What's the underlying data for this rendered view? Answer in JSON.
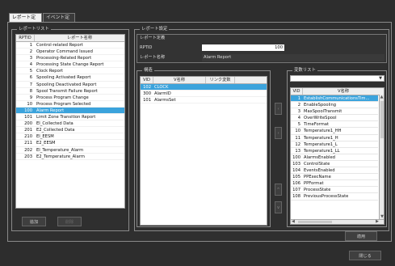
{
  "tabs": [
    "レポート定義",
    "イベント定義"
  ],
  "report_list": {
    "label": "レポートリスト",
    "header_id": "RPTID",
    "header_name": "レポート名称",
    "items": [
      {
        "id": "1",
        "name": "Control-related Report"
      },
      {
        "id": "2",
        "name": "Operator Command Issued"
      },
      {
        "id": "3",
        "name": "Processing-Related Report"
      },
      {
        "id": "4",
        "name": "Processing State Change Report"
      },
      {
        "id": "5",
        "name": "Clock Report"
      },
      {
        "id": "6",
        "name": "Spooling Activated Report"
      },
      {
        "id": "7",
        "name": "Spooling Deactivated Report"
      },
      {
        "id": "8",
        "name": "Spool Transmit Failure Report"
      },
      {
        "id": "9",
        "name": "Process Program Change"
      },
      {
        "id": "10",
        "name": "Process Program Selected"
      },
      {
        "id": "100",
        "name": "Alarm Report"
      },
      {
        "id": "101",
        "name": "Limit Zone Transition Report"
      },
      {
        "id": "200",
        "name": "EI_Collected Data"
      },
      {
        "id": "201",
        "name": "E2_Collected Data"
      },
      {
        "id": "210",
        "name": "EI_EESM"
      },
      {
        "id": "211",
        "name": "E2_EESM"
      },
      {
        "id": "202",
        "name": "EI_Temperature_Alarm"
      },
      {
        "id": "203",
        "name": "E2_Temperature_Alarm"
      }
    ],
    "selected_index": 10,
    "add_button": "追加",
    "delete_button": "削除"
  },
  "report_settings": {
    "label": "レポート設定",
    "sub_label": "レポート定義",
    "rptid_label": "RPTID",
    "rptid_value": "100",
    "name_label": "レポート名称",
    "name_value": "Alarm Report"
  },
  "structure": {
    "label": "構造",
    "header_vid": "VID",
    "header_name": "V名称",
    "header_link": "リンク変数",
    "rows": [
      {
        "vid": "102",
        "name": "CLOCK",
        "link": ""
      },
      {
        "vid": "300",
        "name": "AlarmID",
        "link": ""
      },
      {
        "vid": "101",
        "name": "AlarmsSet",
        "link": ""
      }
    ],
    "selected_index": 0
  },
  "variable_list": {
    "label": "変数リスト",
    "header_vid": "VID",
    "header_name": "V名称",
    "items": [
      {
        "vid": "1",
        "name": "EstablishCommunicationsTim..."
      },
      {
        "vid": "2",
        "name": "EnableSpooling"
      },
      {
        "vid": "3",
        "name": "MaxSpoolTransmit"
      },
      {
        "vid": "4",
        "name": "OverWriteSpool"
      },
      {
        "vid": "5",
        "name": "TimeFormat"
      },
      {
        "vid": "10",
        "name": "Temperature1_HH"
      },
      {
        "vid": "11",
        "name": "Temperature1_H"
      },
      {
        "vid": "12",
        "name": "Temperature1_L"
      },
      {
        "vid": "13",
        "name": "Temperature1_LL"
      },
      {
        "vid": "100",
        "name": "AlarmsEnabled"
      },
      {
        "vid": "103",
        "name": "ControlState"
      },
      {
        "vid": "104",
        "name": "EventsEnabled"
      },
      {
        "vid": "105",
        "name": "PPExecName"
      },
      {
        "vid": "106",
        "name": "PPFormat"
      },
      {
        "vid": "107",
        "name": "ProcessState"
      },
      {
        "vid": "108",
        "name": "PreviousProcessState"
      }
    ],
    "selected_index": 0
  },
  "buttons": {
    "apply": "適用",
    "close": "閉じる"
  },
  "colors": {
    "selection": "#3ba3dc",
    "background": "#2d2d2d"
  }
}
